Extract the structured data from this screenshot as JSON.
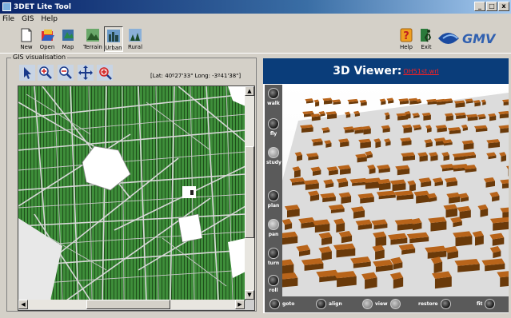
{
  "window": {
    "title": "3DET Lite Tool",
    "min": "_",
    "max": "□",
    "close": "x"
  },
  "menu": [
    "File",
    "GIS",
    "Help"
  ],
  "toolbar": {
    "new": "New",
    "open": "Open",
    "map": "Map",
    "terrain": "Terrain",
    "urban": "Urban",
    "rural": "Rural",
    "help": "Help",
    "exit": "Exit"
  },
  "brand": "GMV",
  "gis": {
    "label": "GIS visualisation",
    "coords": "[Lat: 40º27'33\" Long: -3º41'38\"]",
    "tools": [
      "pointer-icon",
      "zoom-in-icon",
      "zoom-out-icon",
      "pan-icon",
      "zoom-point-icon"
    ]
  },
  "viewer": {
    "title": "3D Viewer:",
    "file": "OH51st.wrl",
    "side": [
      "walk",
      "fly",
      "study",
      "plan",
      "pan",
      "turn",
      "roll"
    ],
    "bottom": {
      "goto": "goto",
      "align": "align",
      "view": "view",
      "restore": "restore",
      "fit": "fit"
    }
  },
  "colors": {
    "map_green": "#3a8a3a",
    "building": "#b8641a",
    "viewer_header": "#0a3d7a"
  }
}
